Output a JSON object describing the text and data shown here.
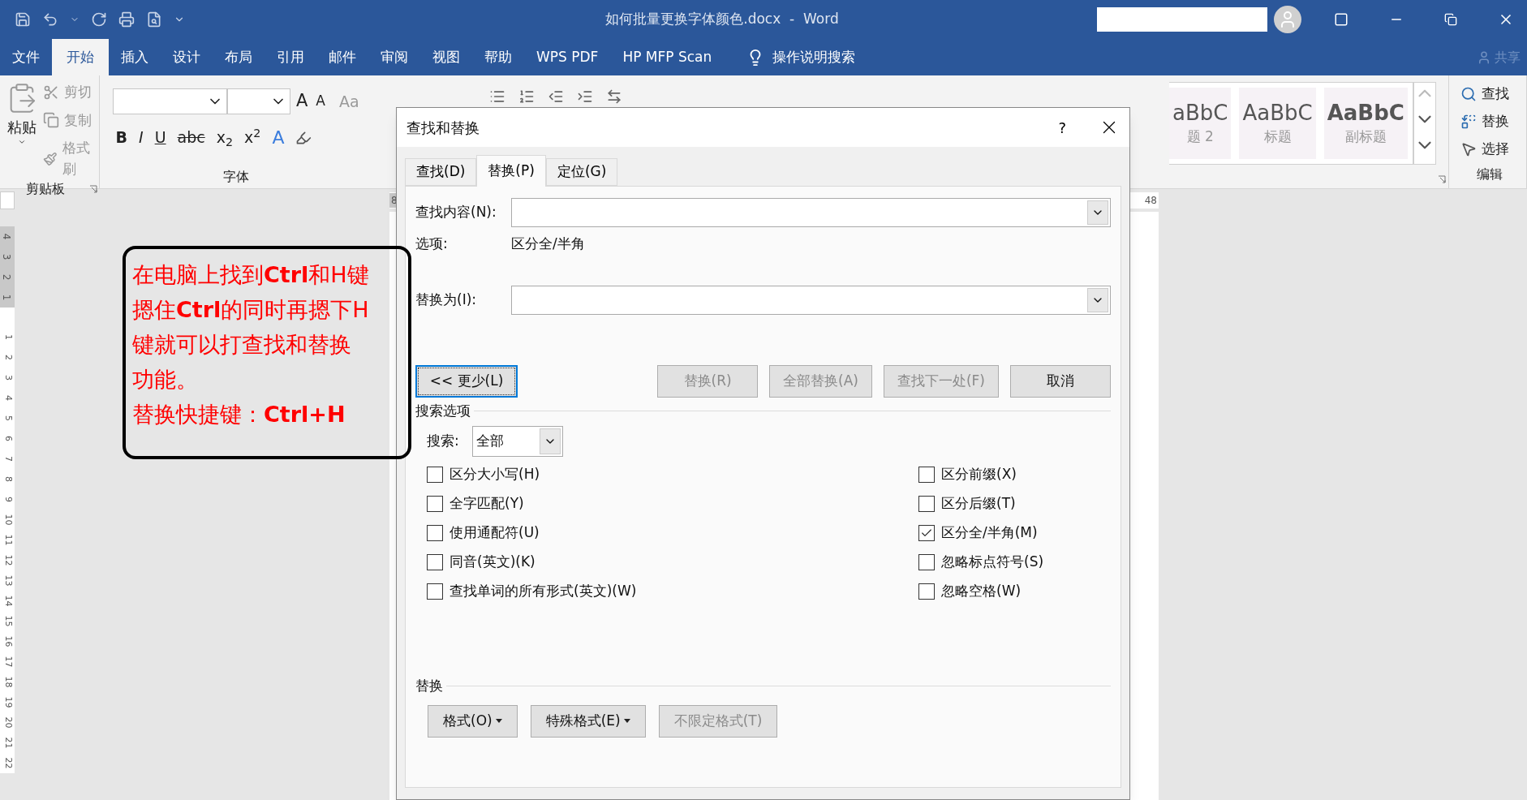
{
  "window": {
    "title": "如何批量更换字体颜色.docx  -  Word"
  },
  "ribbon_tabs": [
    {
      "label": "文件",
      "selected": false
    },
    {
      "label": "开始",
      "selected": true
    },
    {
      "label": "插入",
      "selected": false
    },
    {
      "label": "设计",
      "selected": false
    },
    {
      "label": "布局",
      "selected": false
    },
    {
      "label": "引用",
      "selected": false
    },
    {
      "label": "邮件",
      "selected": false
    },
    {
      "label": "审阅",
      "selected": false
    },
    {
      "label": "视图",
      "selected": false
    },
    {
      "label": "帮助",
      "selected": false
    },
    {
      "label": "WPS PDF",
      "selected": false
    },
    {
      "label": "HP MFP Scan",
      "selected": false
    }
  ],
  "tell_me": "操作说明搜索",
  "share": "共享",
  "clipboard": {
    "paste": "粘贴",
    "label": "剪贴板",
    "commands": [
      {
        "label": "剪切",
        "disabled": true
      },
      {
        "label": "复制",
        "disabled": true
      },
      {
        "label": "格式刷",
        "disabled": true
      }
    ]
  },
  "font": {
    "label": "字体",
    "size_buttons": [
      "A",
      "A"
    ],
    "case_button": "Aa",
    "format_buttons": [
      "B",
      "I",
      "U",
      "abc",
      "x$_{2}$",
      "x$^{2}$"
    ],
    "effects_button": "A"
  },
  "styles": [
    {
      "sample": "aBbC",
      "name": "题 2",
      "bold": false
    },
    {
      "sample": "AaBbC",
      "name": "标题",
      "bold": false
    },
    {
      "sample": "AaBbC",
      "name": "副标题",
      "bold": true
    }
  ],
  "editing": {
    "label": "编辑",
    "commands": [
      "查找",
      "替换",
      "选择"
    ]
  },
  "ruler": {
    "marks": [
      "8",
      "48"
    ]
  },
  "vertical_ruler": {
    "shaded": [
      "4",
      "3",
      "2",
      "1"
    ],
    "marks": [
      "1",
      "2",
      "3",
      "4",
      "5",
      "6",
      "7",
      "8",
      "9",
      "10",
      "11",
      "12",
      "13",
      "14",
      "15",
      "16",
      "17",
      "18",
      "19",
      "20",
      "21",
      "22"
    ]
  },
  "note": {
    "lines": [
      "在电脑上找到**Ctrl**和H键",
      "摁住**Ctrl**的同时再摁下H",
      "键就可以打查找和替换",
      "功能。",
      "替换快捷键：**Ctrl+H**"
    ]
  },
  "dialog": {
    "title": "查找和替换",
    "help": "?",
    "tabs": [
      {
        "label": "查找(D)",
        "selected": false
      },
      {
        "label": "替换(P)",
        "selected": true
      },
      {
        "label": "定位(G)",
        "selected": false
      }
    ],
    "find_label": "查找内容(N):",
    "options_label": "选项:",
    "options_value": "区分全/半角",
    "replace_label": "替换为(I):",
    "more_button": "<< 更少(L)",
    "actions": [
      {
        "label": "替换(R)",
        "disabled": true
      },
      {
        "label": "全部替换(A)",
        "disabled": true
      },
      {
        "label": "查找下一处(F)",
        "disabled": true
      },
      {
        "label": "取消",
        "disabled": false
      }
    ],
    "search_options_heading": "搜索选项",
    "search_label": "搜索:",
    "search_value": "全部",
    "options": [
      {
        "label": "区分大小写(H)",
        "checked": false
      },
      {
        "label": "全字匹配(Y)",
        "checked": false
      },
      {
        "label": "使用通配符(U)",
        "checked": false
      },
      {
        "label": "同音(英文)(K)",
        "checked": false
      },
      {
        "label": "查找单词的所有形式(英文)(W)",
        "checked": false
      }
    ],
    "options_right": [
      {
        "label": "区分前缀(X)",
        "checked": false
      },
      {
        "label": "区分后缀(T)",
        "checked": false
      },
      {
        "label": "区分全/半角(M)",
        "checked": true
      },
      {
        "label": "忽略标点符号(S)",
        "checked": false
      },
      {
        "label": "忽略空格(W)",
        "checked": false
      }
    ],
    "replace_heading": "替换",
    "format_buttons": [
      {
        "label": "格式(O)",
        "menu": true,
        "disabled": false
      },
      {
        "label": "特殊格式(E)",
        "menu": true,
        "disabled": false
      },
      {
        "label": "不限定格式(T)",
        "menu": false,
        "disabled": true
      }
    ]
  }
}
